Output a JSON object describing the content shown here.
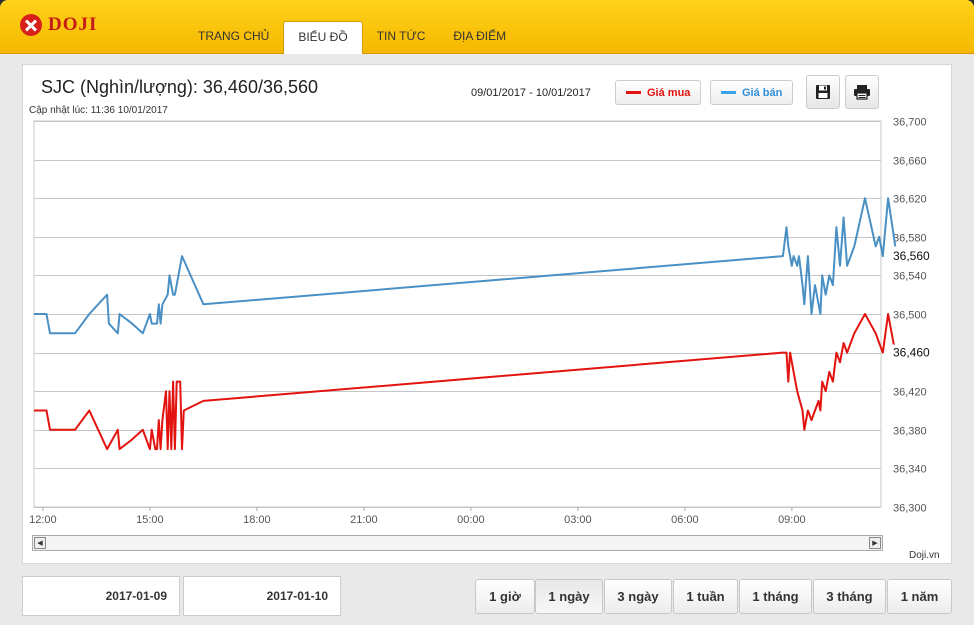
{
  "header": {
    "logo_text": "DOJI",
    "nav": [
      "TRANG CHỦ",
      "BIỂU ĐỒ",
      "TIN TỨC",
      "ĐỊA ĐIỂM"
    ],
    "active_nav": "BIỂU ĐỒ"
  },
  "panel": {
    "title": "SJC (Nghìn/lượng): 36,460/36,560",
    "updated": "Cập nhật lúc: 11:36 10/01/2017",
    "date_range": "09/01/2017 - 10/01/2017",
    "legend_buy": "Giá mua",
    "legend_sell": "Giá bán",
    "source": "Doji.vn",
    "save_icon": "save-icon",
    "print_icon": "print-icon"
  },
  "colors": {
    "buy": "#e3130f",
    "sell": "#4a90c4",
    "accent": "#f5b800"
  },
  "footer": {
    "date_from": "2017-01-09",
    "date_to": "2017-01-10",
    "ranges": [
      "1 giờ",
      "1 ngày",
      "3 ngày",
      "1 tuần",
      "1 tháng",
      "3 tháng",
      "1 năm"
    ],
    "active_range": "1 ngày"
  },
  "chart_data": {
    "type": "line",
    "x_ticks": [
      "12:00",
      "15:00",
      "18:00",
      "21:00",
      "00:00",
      "03:00",
      "06:00",
      "09:00"
    ],
    "xlim": [
      11.75,
      35.5
    ],
    "ylim": [
      36300,
      36700
    ],
    "y_ticks": [
      36300,
      36340,
      36380,
      36420,
      36460,
      36500,
      36540,
      36580,
      36620,
      36660,
      36700
    ],
    "y_tick_labels": [
      "36,300",
      "36,340",
      "36,380",
      "36,420",
      "36,460",
      "36,500",
      "36,540",
      "36,580",
      "36,620",
      "36,660",
      "36,700"
    ],
    "grid": true,
    "current_labels": [
      {
        "value": 36560,
        "text": "36,560"
      },
      {
        "value": 36460,
        "text": "36,460"
      }
    ],
    "series": [
      {
        "name": "Giá bán",
        "color": "#4a90c4",
        "points": [
          [
            11.75,
            36500
          ],
          [
            12.1,
            36500
          ],
          [
            12.2,
            36480
          ],
          [
            12.9,
            36480
          ],
          [
            13.3,
            36500
          ],
          [
            13.8,
            36520
          ],
          [
            13.85,
            36490
          ],
          [
            14.1,
            36480
          ],
          [
            14.15,
            36500
          ],
          [
            14.5,
            36490
          ],
          [
            14.8,
            36480
          ],
          [
            15.0,
            36500
          ],
          [
            15.05,
            36490
          ],
          [
            15.2,
            36490
          ],
          [
            15.25,
            36510
          ],
          [
            15.3,
            36490
          ],
          [
            15.35,
            36510
          ],
          [
            15.5,
            36520
          ],
          [
            15.55,
            36540
          ],
          [
            15.65,
            36520
          ],
          [
            15.7,
            36520
          ],
          [
            15.9,
            36560
          ],
          [
            16.5,
            36510
          ],
          [
            32.75,
            36560
          ],
          [
            32.85,
            36590
          ],
          [
            32.9,
            36570
          ],
          [
            32.95,
            36560
          ],
          [
            33.0,
            36550
          ],
          [
            33.05,
            36560
          ],
          [
            33.15,
            36550
          ],
          [
            33.2,
            36560
          ],
          [
            33.3,
            36530
          ],
          [
            33.35,
            36510
          ],
          [
            33.45,
            36560
          ],
          [
            33.55,
            36500
          ],
          [
            33.65,
            36530
          ],
          [
            33.75,
            36510
          ],
          [
            33.8,
            36500
          ],
          [
            33.85,
            36540
          ],
          [
            33.95,
            36520
          ],
          [
            34.05,
            36540
          ],
          [
            34.15,
            36530
          ],
          [
            34.25,
            36590
          ],
          [
            34.35,
            36550
          ],
          [
            34.45,
            36600
          ],
          [
            34.55,
            36550
          ],
          [
            34.75,
            36570
          ],
          [
            35.05,
            36620
          ],
          [
            35.35,
            36570
          ],
          [
            35.45,
            36580
          ],
          [
            35.55,
            36560
          ],
          [
            35.7,
            36620
          ],
          [
            35.9,
            36570
          ]
        ]
      },
      {
        "name": "Giá mua",
        "color": "#e3130f",
        "points": [
          [
            11.75,
            36400
          ],
          [
            12.1,
            36400
          ],
          [
            12.2,
            36380
          ],
          [
            12.9,
            36380
          ],
          [
            13.3,
            36400
          ],
          [
            13.8,
            36360
          ],
          [
            14.1,
            36380
          ],
          [
            14.15,
            36360
          ],
          [
            14.5,
            36370
          ],
          [
            14.8,
            36380
          ],
          [
            15.0,
            36360
          ],
          [
            15.05,
            36380
          ],
          [
            15.15,
            36360
          ],
          [
            15.2,
            36360
          ],
          [
            15.25,
            36390
          ],
          [
            15.3,
            36360
          ],
          [
            15.35,
            36390
          ],
          [
            15.45,
            36420
          ],
          [
            15.5,
            36360
          ],
          [
            15.55,
            36420
          ],
          [
            15.6,
            36360
          ],
          [
            15.65,
            36430
          ],
          [
            15.7,
            36360
          ],
          [
            15.75,
            36430
          ],
          [
            15.85,
            36430
          ],
          [
            15.9,
            36360
          ],
          [
            15.95,
            36400
          ],
          [
            16.5,
            36410
          ],
          [
            32.75,
            36460
          ],
          [
            32.85,
            36460
          ],
          [
            32.9,
            36430
          ],
          [
            32.95,
            36460
          ],
          [
            33.05,
            36440
          ],
          [
            33.15,
            36420
          ],
          [
            33.3,
            36400
          ],
          [
            33.35,
            36380
          ],
          [
            33.45,
            36400
          ],
          [
            33.55,
            36390
          ],
          [
            33.65,
            36400
          ],
          [
            33.75,
            36410
          ],
          [
            33.8,
            36400
          ],
          [
            33.85,
            36430
          ],
          [
            33.95,
            36420
          ],
          [
            34.05,
            36440
          ],
          [
            34.15,
            36430
          ],
          [
            34.25,
            36460
          ],
          [
            34.35,
            36450
          ],
          [
            34.45,
            36470
          ],
          [
            34.55,
            36460
          ],
          [
            34.75,
            36480
          ],
          [
            35.05,
            36500
          ],
          [
            35.35,
            36480
          ],
          [
            35.45,
            36470
          ],
          [
            35.55,
            36460
          ],
          [
            35.7,
            36500
          ],
          [
            35.9,
            36460
          ]
        ]
      }
    ]
  }
}
